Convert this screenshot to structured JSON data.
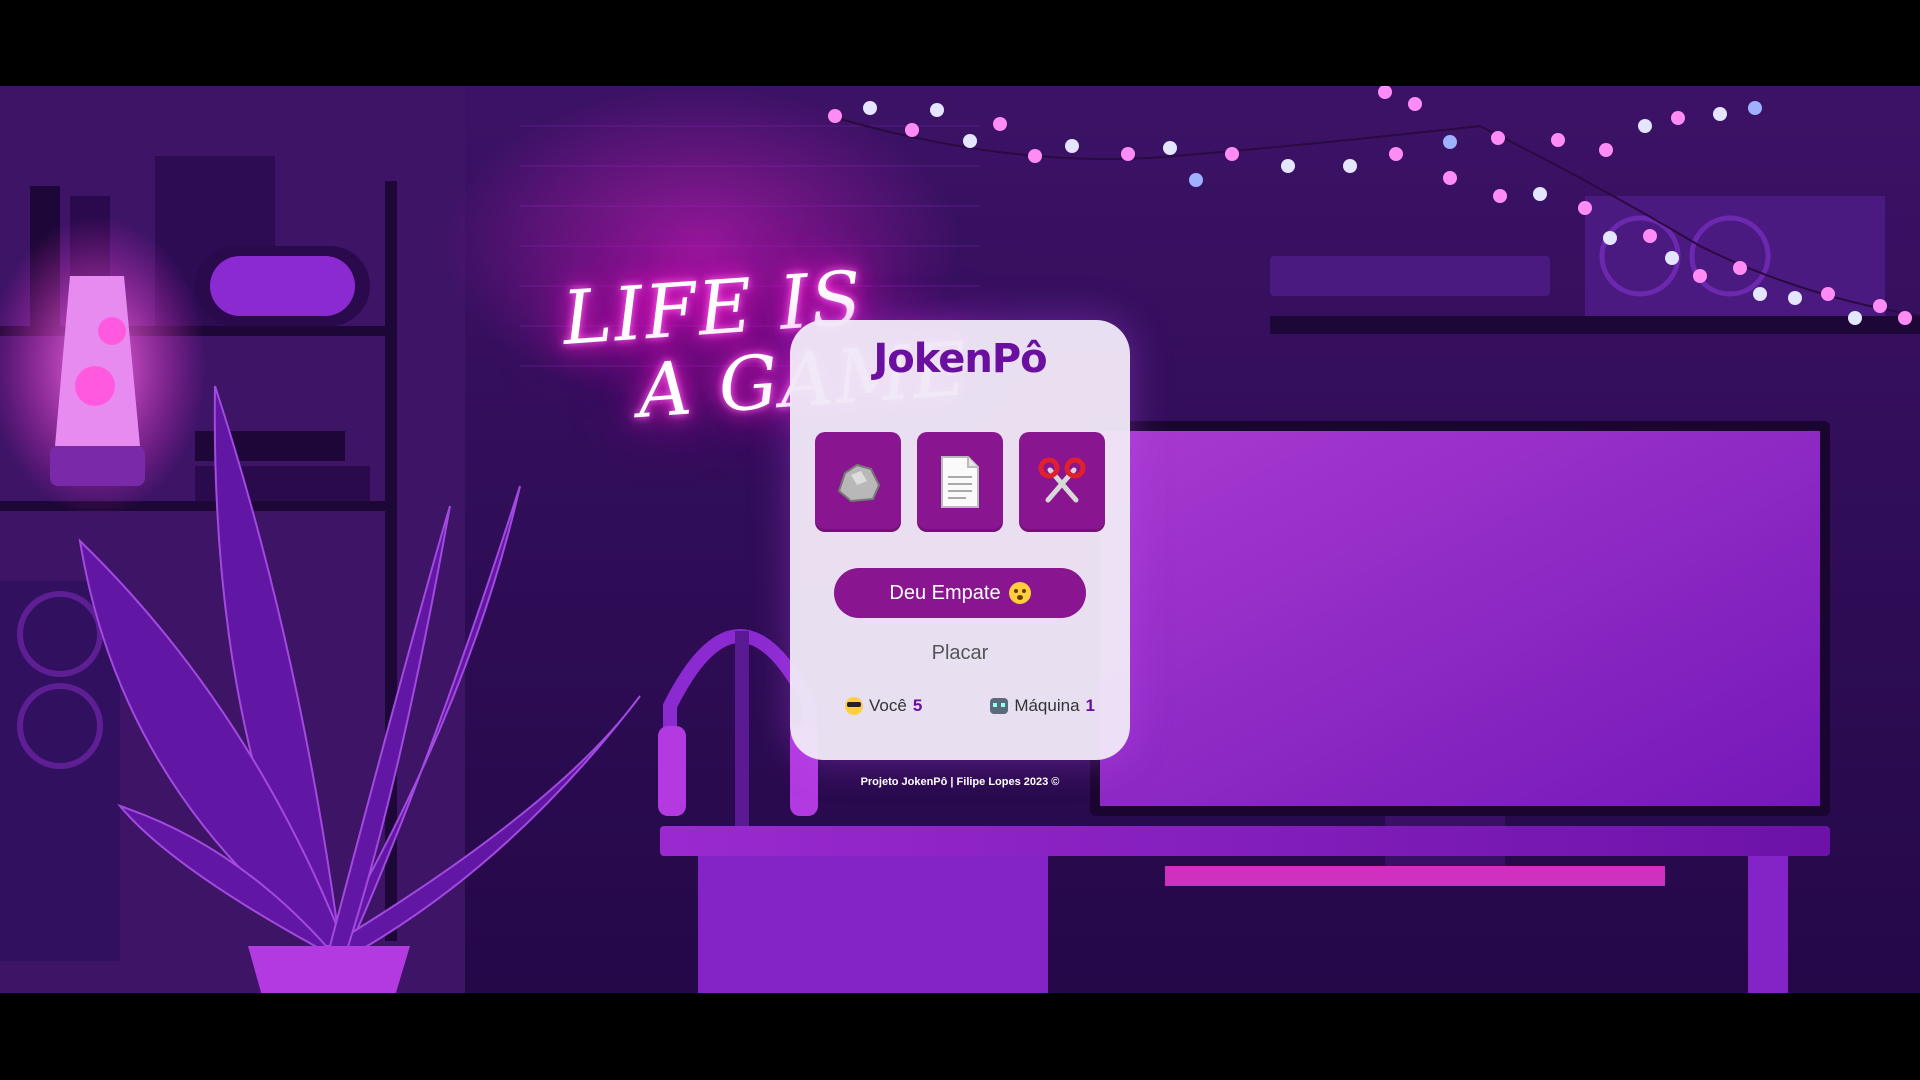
{
  "scene": {
    "neon_line1": "LIFE IS",
    "neon_line2": "A GAME"
  },
  "game": {
    "title": "JokenPô",
    "choices": [
      {
        "name": "pedra",
        "icon": "rock-icon"
      },
      {
        "name": "papel",
        "icon": "paper-icon"
      },
      {
        "name": "tesoura",
        "icon": "scissors-icon"
      }
    ],
    "result_label": "Deu Empate",
    "result_icon": "astonished-face-icon",
    "scoreboard_label": "Placar",
    "player_label": "Você",
    "player_score": "5",
    "machine_label": "Máquina",
    "machine_score": "1"
  },
  "footer": "Projeto JokenPô | Filipe Lopes 2023 ©",
  "colors": {
    "brand": "#6a0fa0",
    "button": "#8a1590",
    "card": "#f0e8f8"
  }
}
